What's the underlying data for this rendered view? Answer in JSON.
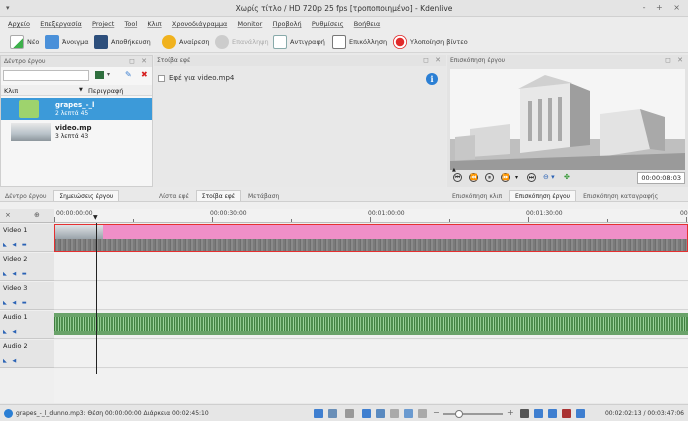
{
  "window": {
    "title": "Χωρίς τίτλο / HD 720p 25 fps [τροποποιημένο] - Kdenlive",
    "controls": "- + ×"
  },
  "menu": [
    "Αρχείο",
    "Επεξεργασία",
    "Project",
    "Tool",
    "Κλιπ",
    "Χρονοδιάγραμμα",
    "Monitor",
    "Προβολή",
    "Ρυθμίσεις",
    "Βοήθεια"
  ],
  "toolbar": {
    "new": "Νέο",
    "open": "Άνοιγμα",
    "save": "Αποθήκευση",
    "undo": "Αναίρεση",
    "redo": "Επανάληψη",
    "copy": "Αντιγραφή",
    "paste": "Επικόλληση",
    "render": "Υλοποίηση βίντεο"
  },
  "project": {
    "panel_title": "Δέντρο έργου",
    "col_clip": "Κλιπ",
    "col_desc": "Περιγραφή",
    "clips": [
      {
        "name": "grapes_-_l",
        "duration": "2 λεπτά 45"
      },
      {
        "name": "video.mp",
        "duration": "3 λεπτά 43"
      }
    ],
    "tabs": [
      "Δέντρο έργου",
      "Σημειώσεις έργου"
    ]
  },
  "effects": {
    "panel_title": "Στοίβα εφέ",
    "checkbox_label": "Εφέ για video.mp4",
    "tabs": [
      "Λίστα εφέ",
      "Στοίβα εφέ",
      "Μετάβαση"
    ]
  },
  "monitor": {
    "panel_title": "Επισκόπηση έργου",
    "timecode": "00:00:08:03",
    "tabs": [
      "Επισκόπηση κλιπ",
      "Επισκόπηση έργου",
      "Επισκόπηση καταγραφής"
    ]
  },
  "timeline": {
    "ruler": [
      "00:00:00:00",
      "00:00:30:00",
      "00:01:00:00",
      "00:01:30:00",
      "00"
    ],
    "tracks": [
      "Video 1",
      "Video 2",
      "Video 3",
      "Audio 1",
      "Audio 2"
    ]
  },
  "status": {
    "text": "grapes_-_l_dunno.mp3: Θέση 00:00:00:00 Διάρκεια 00:02:45:10",
    "timecode": "00:02:02:13 / 00:03:47:06"
  },
  "colors": {
    "selection": "#3c9ad9",
    "video_clip": "#f08fc8",
    "audio_clip": "#6aa36a",
    "track_border_selected": "#e53030"
  }
}
